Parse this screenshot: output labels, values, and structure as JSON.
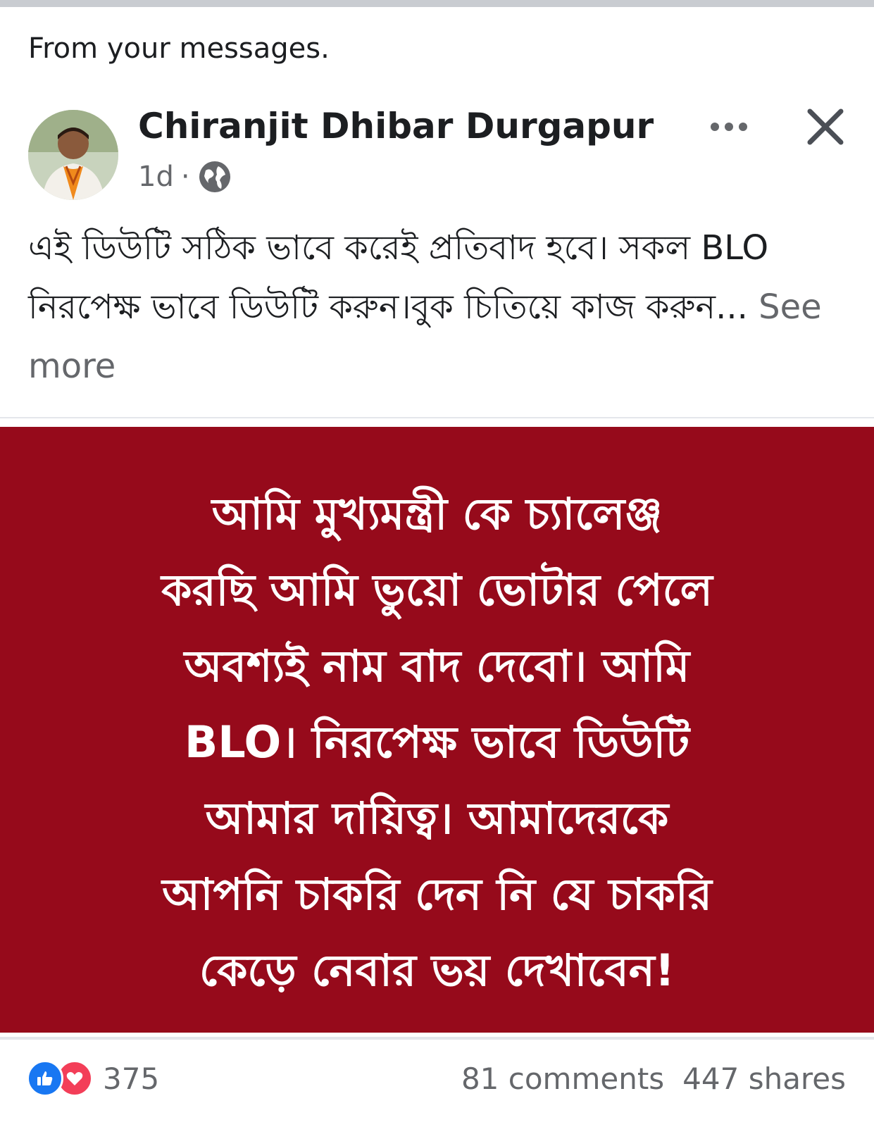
{
  "context_label": "From your messages.",
  "post": {
    "author": "Chiranjit Dhibar Durgapur",
    "time": "1d",
    "separator": "·",
    "privacy_icon": "globe-icon",
    "text": "এই ডিউটি সঠিক ভাবে করেই প্রতিবাদ হবে। সকল BLO নিরপেক্ষ ভাবে ডিউটি করুন।বুক চিতিয়ে কাজ করুন...",
    "see_more": "See more"
  },
  "image": {
    "background": "#960a1b",
    "lines": [
      "আমি মুখ্যমন্ত্রী কে চ্যালেঞ্জ",
      "করছি আমি ভুয়ো ভোটার পেলে",
      "অবশ্যই নাম বাদ দেবো। আমি",
      "BLO। নিরপেক্ষ ভাবে ডিউটি",
      "আমার দায়িত্ব। আমাদেরকে",
      "আপনি চাকরি দেন নি যে চাকরি",
      "কেড়ে নেবার ভয় দেখাবেন!"
    ]
  },
  "footer": {
    "reaction_icons": [
      "like-icon",
      "love-icon"
    ],
    "reaction_count": "375",
    "comments": "81 comments",
    "shares": "447 shares"
  },
  "colors": {
    "like": "#1877f2",
    "love": "#f33e58",
    "secondary_text": "#65676b"
  }
}
